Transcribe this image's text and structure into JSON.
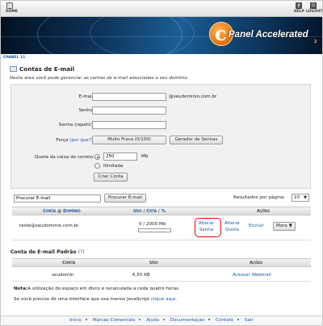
{
  "topbar": {
    "home_label": "HOME",
    "help_label": "HELP",
    "logout_label": "LOGOUT",
    "help_glyph": "?"
  },
  "banner": {
    "logo_glyph": "c",
    "logo_text": "Panel Accelerated",
    "logo_sub": "2"
  },
  "breadcrumb": "CPANEL 11",
  "page": {
    "title": "Contas de E-mail",
    "intro": "Nesta área você pode gerenciar as contas de e-mail associadas a seu domínio."
  },
  "form": {
    "email_label": "E-mail:",
    "email_value": "",
    "domain_suffix": "@seudominio.com.br",
    "password_label": "Senha:",
    "password_repeat_label": "Senha (repetir):",
    "strength_label": "Força",
    "strength_why": "(por que?)",
    "strength_value": "Muito Fraca (0/100)",
    "generator_button": "Gerador de Senhas",
    "quota_label": "Quota da caixa do correio:",
    "quota_value": "250",
    "quota_unit": "Mb",
    "unlimited_label": "Ilimitada",
    "quota_selected": "250",
    "create_button": "Criar Conta"
  },
  "search": {
    "value": "Procurar E-mail",
    "button": "Procurar E-mail",
    "per_page_label": "Resultados por página:",
    "per_page_value": "10"
  },
  "accounts_table": {
    "headers": {
      "account": "Conta",
      "at": "@",
      "domain": "Domínio",
      "usage": "Uso",
      "slash": "/",
      "quota": "Cota",
      "slash2": "/",
      "percent": "%",
      "actions": "Ações"
    },
    "rows": [
      {
        "account": "teste@seudominio.com.br",
        "usage": "0 / 2000 Mb",
        "usage_fraction": 0.0,
        "change_password_line1": "Alterar",
        "change_password_line2": "Senha",
        "change_quota_line1": "Alterar",
        "change_quota_line2": "Quota",
        "delete": "Excluir",
        "more": "More ▼"
      }
    ]
  },
  "default_account": {
    "title": "Conta de E-mail Padrão",
    "help": "(?)",
    "headers": {
      "account": "Conta",
      "usage": "Uso",
      "actions": "Ações"
    },
    "row": {
      "account": "seudomin",
      "usage": "6,55 KB",
      "action": "Acessar Webmail"
    }
  },
  "notes": {
    "note_bold": "Nota:",
    "note_text": "A utilização do espaço em disco é recalculada a cada quatro horas.",
    "js_text": "Se você precisa de uma interface que usa menos JavaScript",
    "js_link": "clique aqui."
  },
  "footer": {
    "links": [
      "Início",
      "Marcas Comerciais",
      "Ajuda",
      "Documentação",
      "Contato",
      "Sair"
    ]
  },
  "colors": {
    "link": "#1a5aa6",
    "highlight": "#e00000",
    "banner_dark": "#02101f",
    "logo_orange": "#e46c0a"
  }
}
